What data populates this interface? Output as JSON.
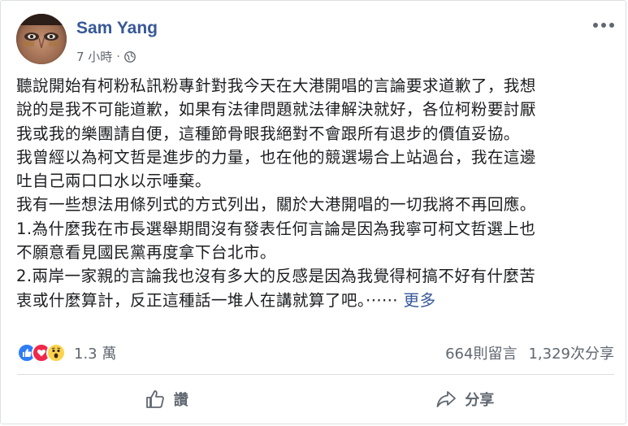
{
  "post": {
    "author": "Sam Yang",
    "time": "7 小時",
    "separator": "·",
    "privacy_icon": "globe-icon",
    "paragraphs": [
      "聽說開始有柯粉私訊粉專針對我今天在大港開唱的言論要求道歉了，我想",
      "說的是我不可能道歉，如果有法律問題就法律解決就好，各位柯粉要討厭",
      "我或我的樂團請自便，這種節骨眼我絕對不會跟所有退步的價值妥協。",
      "我曾經以為柯文哲是進步的力量，也在他的競選場合上站過台，我在這邊",
      "吐自己兩口口水以示唾棄。",
      "我有一些想法用條列式的方式列出，關於大港開唱的一切我將不再回應。",
      "1.為什麼我在市長選舉期間沒有發表任何言論是因為我寧可柯文哲選上也",
      "不願意看見國民黨再度拿下台北市。",
      "2.兩岸一家親的言論我也沒有多大的反感是因為我覺得柯搞不好有什麼苦",
      "衷或什麼算計，反正這種話一堆人在講就算了吧。······ "
    ],
    "see_more": "更多"
  },
  "reactions": {
    "icons": [
      "like-icon",
      "love-icon",
      "wow-icon"
    ],
    "count": "1.3 萬",
    "comments": "664則留言",
    "shares": "1,329次分享"
  },
  "actions": {
    "like": "讚",
    "share": "分享"
  },
  "colors": {
    "author": "#385898",
    "secondary": "#606770",
    "like": "#2f7cf6",
    "love": "#f0284a",
    "wow": "#fcd34d"
  }
}
